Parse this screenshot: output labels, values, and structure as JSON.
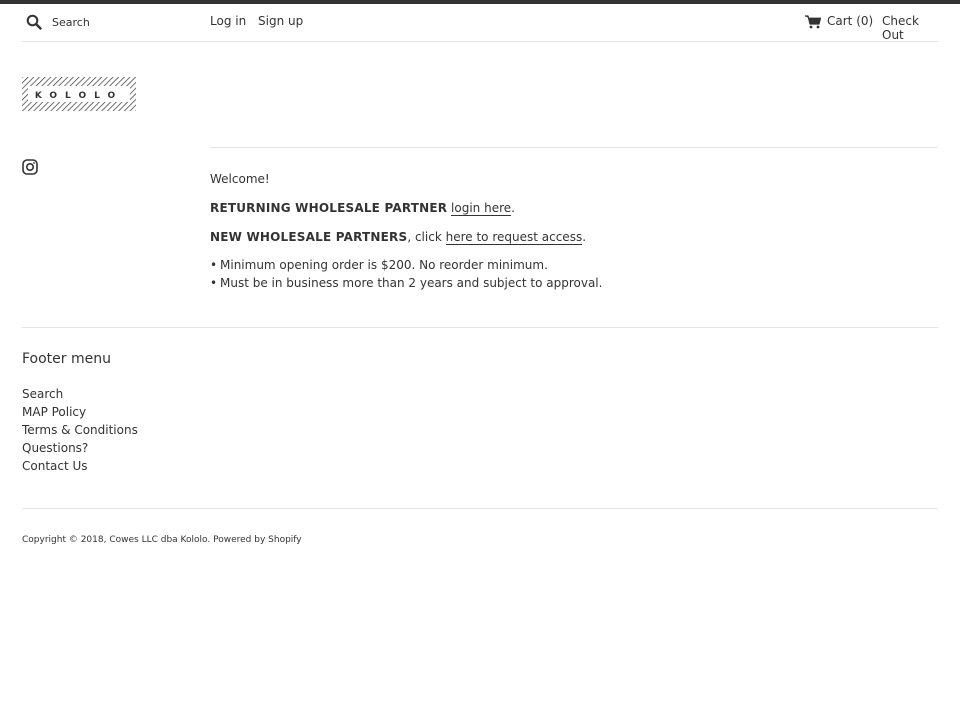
{
  "header": {
    "search_placeholder": "Search",
    "login_label": "Log in",
    "signup_label": "Sign up",
    "cart_label": "Cart",
    "cart_count": "(0)",
    "checkout_label": "Check Out"
  },
  "brand": {
    "logo_text": "KOLOLO"
  },
  "main": {
    "welcome": "Welcome!",
    "returning_heading": "RETURNING WHOLESALE PARTNER",
    "returning_link": "login here",
    "returning_period": ".",
    "new_heading": "NEW WHOLESALE PARTNERS",
    "new_text": ", click",
    "new_link": "here to request access",
    "new_period": ".",
    "bullets": [
      "Minimum opening order is $200. No reorder minimum.",
      "Must be in business more than 2 years and subject to approval."
    ]
  },
  "footer": {
    "menu_title": "Footer menu",
    "links": [
      "Search",
      "MAP Policy",
      "Terms & Conditions",
      "Questions?",
      "Contact Us"
    ],
    "copyright": "Copyright © 2018,",
    "company_link": "Cowes LLC dba Kololo",
    "powered_link": "Powered by Shopify"
  },
  "colors": {
    "text": "#333333",
    "rule": "#e4e4e4",
    "background": "#ffffff"
  }
}
